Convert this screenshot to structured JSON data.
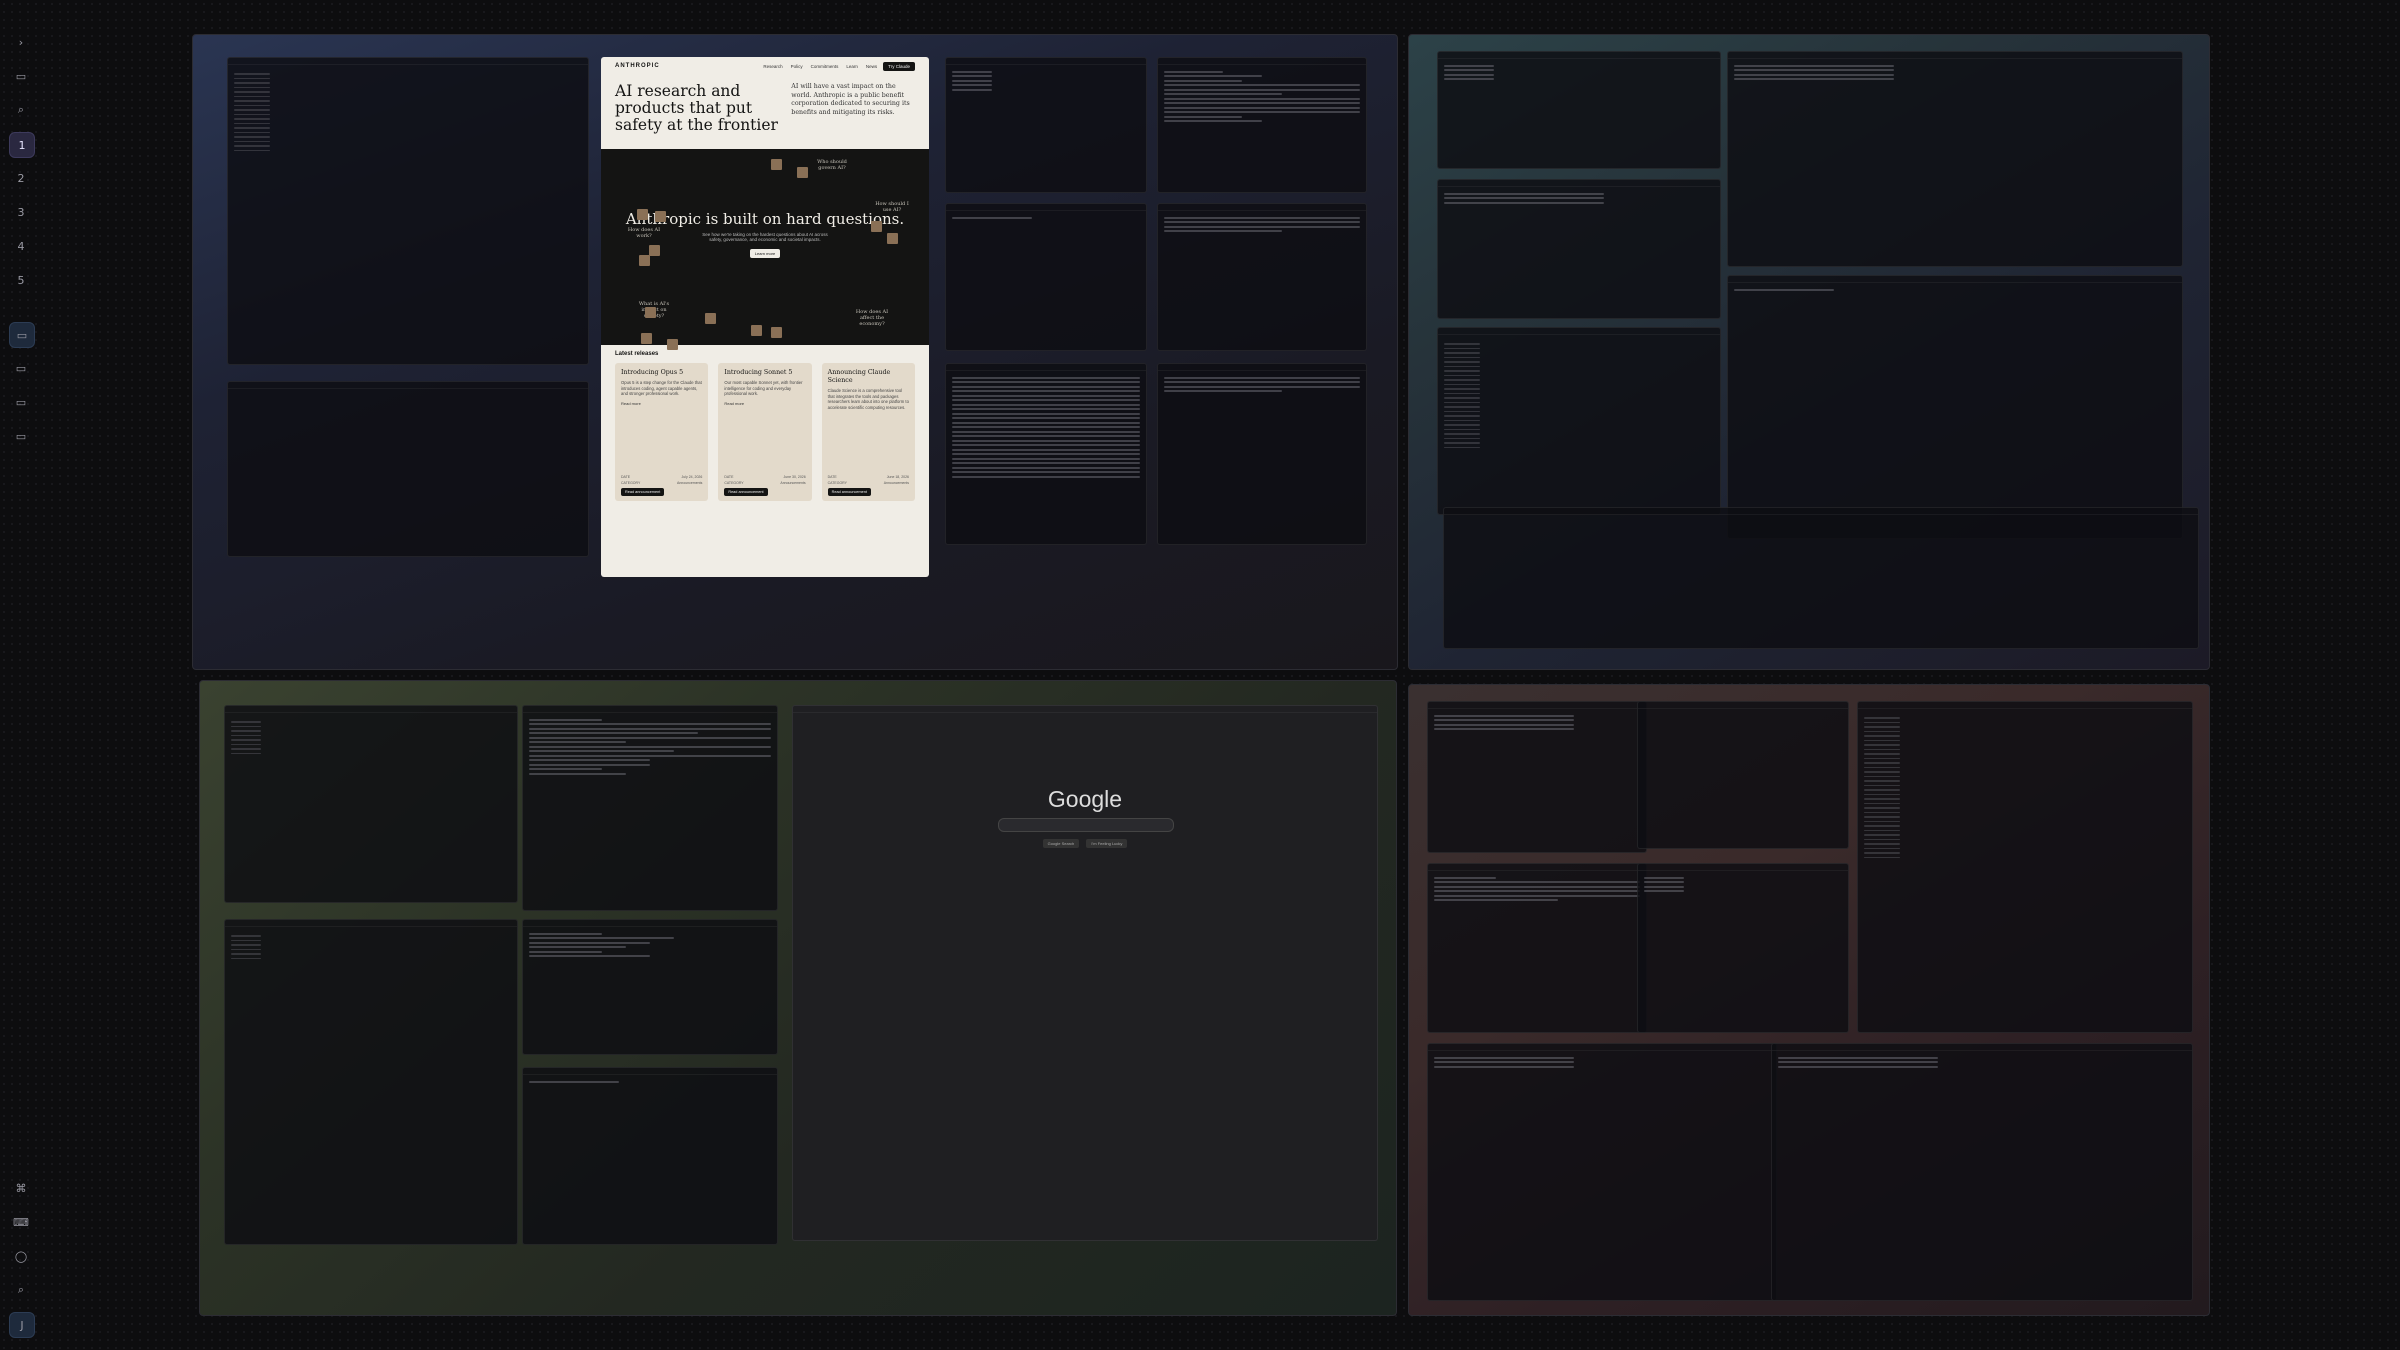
{
  "rail": {
    "items": [
      {
        "glyph": "›",
        "name": "expand"
      },
      {
        "glyph": "▭",
        "name": "windows"
      },
      {
        "glyph": "⌕",
        "name": "search"
      },
      {
        "glyph": "1",
        "name": "space-1",
        "active": true
      },
      {
        "glyph": "2",
        "name": "space-2"
      },
      {
        "glyph": "3",
        "name": "space-3"
      },
      {
        "glyph": "4",
        "name": "space-4"
      },
      {
        "glyph": "5",
        "name": "space-5"
      }
    ],
    "bottom": [
      {
        "glyph": "⌘",
        "name": "command"
      },
      {
        "glyph": "⌨",
        "name": "keyboard"
      },
      {
        "glyph": "◯",
        "name": "status"
      },
      {
        "glyph": "⌕",
        "name": "find"
      },
      {
        "glyph": "J",
        "name": "profile"
      }
    ]
  },
  "anthropic": {
    "logo": "ANTHROPIC",
    "nav": [
      "Research",
      "Policy",
      "Commitments",
      "Learn",
      "News"
    ],
    "cta": "Try Claude",
    "headline": "AI research and products that put safety at the frontier",
    "intro": "AI will have a vast impact on the world. Anthropic is a public benefit corporation dedicated to securing its benefits and mitigating its risks.",
    "dark_title": "Anthropic is built on hard questions.",
    "dark_sub": "See how we're taking on the hardest questions about AI across safety, governance, and economic and societal impacts.",
    "learn_more": "Learn more",
    "questions": [
      "How does AI work?",
      "Who should govern AI?",
      "How should I use AI?",
      "What is AI's impact on society?",
      "How does AI affect the economy?"
    ],
    "releases_title": "Latest releases",
    "cards": [
      {
        "title": "Introducing Opus 5",
        "body": "Opus 5 is a step change for the Claude that introduces coding, agent capable agents, and stronger professional work.",
        "rm": "Read more",
        "date": "July 24, 2026",
        "cat": "Announcements",
        "btn": "Read announcement"
      },
      {
        "title": "Introducing Sonnet 5",
        "body": "Our most capable Sonnet yet, with frontier intelligence for coding and everyday professional work.",
        "rm": "Read more",
        "date": "June 30, 2026",
        "cat": "Announcements",
        "btn": "Read announcement"
      },
      {
        "title": "Announcing Claude Science",
        "body": "Claude Science is a comprehensive tool that integrates the tools and packages researchers learn about into one platform to accelerate scientific computing resources.",
        "rm": "",
        "date": "June 18, 2026",
        "cat": "Announcements",
        "btn": "Read announcement"
      }
    ],
    "date_label": "DATE",
    "cat_label": "CATEGORY"
  },
  "google": {
    "logo": "Google",
    "btn1": "Google Search",
    "btn2": "I'm Feeling Lucky"
  }
}
